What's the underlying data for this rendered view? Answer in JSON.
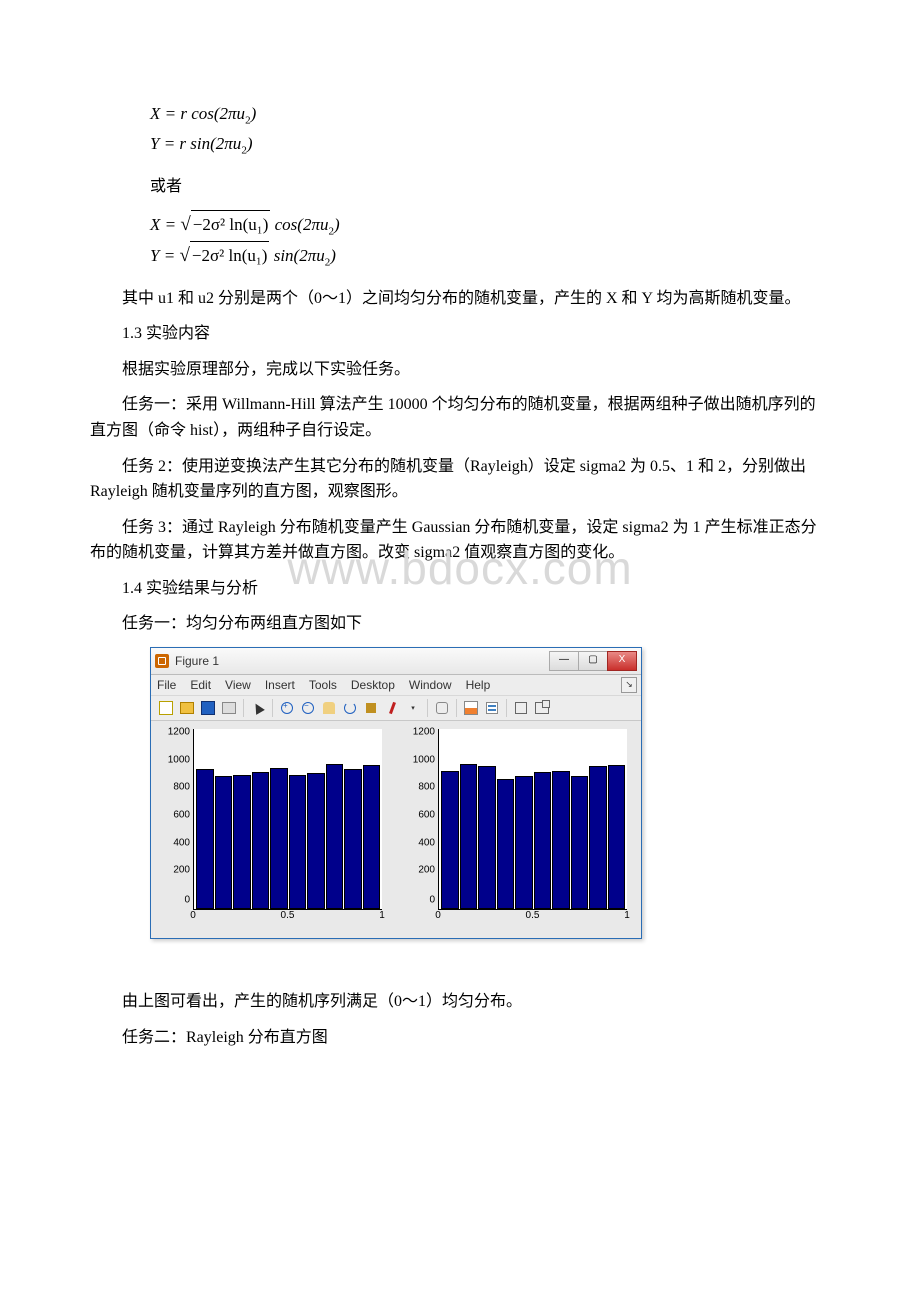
{
  "equations": {
    "e1": "X = r cos(2πu",
    "e1_sub": "2",
    "e1_end": ")",
    "e2": "Y = r sin(2πu",
    "e2_sub": "2",
    "e2_end": ")",
    "or": "或者",
    "e3a": "X = ",
    "e3_rad": "−2σ² ln(u₁)",
    "e3b": " cos(2πu",
    "e3_sub": "2",
    "e3_end": ")",
    "e4a": "Y = ",
    "e4_rad": "−2σ² ln(u₁)",
    "e4b": " sin(2πu",
    "e4_sub": "2",
    "e4_end": ")"
  },
  "body": {
    "p1": "其中 u1 和 u2 分别是两个（0～1）之间均匀分布的随机变量，产生的 X 和 Y 均为高斯随机变量。",
    "h13": "1.3 实验内容",
    "p2": "根据实验原理部分，完成以下实验任务。",
    "task1": "任务一：采用 Willmann-Hill 算法产生 10000 个均匀分布的随机变量，根据两组种子做出随机序列的直方图（命令 hist），两组种子自行设定。",
    "task2": "任务 2：使用逆变换法产生其它分布的随机变量（Rayleigh）设定 sigma2 为 0.5、1 和 2，分别做出 Rayleigh 随机变量序列的直方图，观察图形。",
    "task3": "任务 3：通过 Rayleigh 分布随机变量产生 Gaussian 分布随机变量，设定 sigma2 为 1 产生标准正态分布的随机变量，计算其方差并做直方图。改变 sigma2 值观察直方图的变化。",
    "h14": "1.4 实验结果与分析",
    "res1": "任务一：均匀分布两组直方图如下",
    "concl": "由上图可看出，产生的随机序列满足（0～1）均匀分布。",
    "res2": "任务二：Rayleigh 分布直方图"
  },
  "watermark": "www.bdocx.com",
  "figure": {
    "title": "Figure 1",
    "menu": [
      "File",
      "Edit",
      "View",
      "Insert",
      "Tools",
      "Desktop",
      "Window",
      "Help"
    ],
    "winbtns": {
      "min": "—",
      "max": "▢",
      "close": "X"
    }
  },
  "chart_data": [
    {
      "type": "bar",
      "categories": [
        0.05,
        0.15,
        0.25,
        0.35,
        0.45,
        0.55,
        0.65,
        0.75,
        0.85,
        0.95
      ],
      "values": [
        1010,
        960,
        970,
        990,
        1020,
        970,
        980,
        1050,
        1010,
        1040
      ],
      "xlabel": "",
      "ylabel": "",
      "xlim": [
        0,
        1
      ],
      "ylim": [
        0,
        1300
      ],
      "xticks": [
        0,
        0.5,
        1
      ],
      "yticks": [
        0,
        200,
        400,
        600,
        800,
        1000,
        1200
      ]
    },
    {
      "type": "bar",
      "categories": [
        0.05,
        0.15,
        0.25,
        0.35,
        0.45,
        0.55,
        0.65,
        0.75,
        0.85,
        0.95
      ],
      "values": [
        1000,
        1050,
        1030,
        940,
        960,
        990,
        1000,
        960,
        1030,
        1040
      ],
      "xlabel": "",
      "ylabel": "",
      "xlim": [
        0,
        1
      ],
      "ylim": [
        0,
        1300
      ],
      "xticks": [
        0,
        0.5,
        1
      ],
      "yticks": [
        0,
        200,
        400,
        600,
        800,
        1000,
        1200
      ]
    }
  ]
}
